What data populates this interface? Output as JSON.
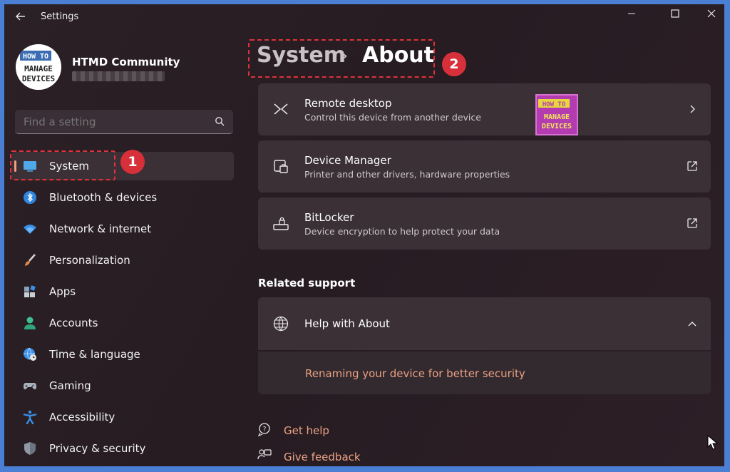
{
  "window": {
    "title": "Settings"
  },
  "profile": {
    "name": "HTMD Community",
    "logo_text_top": "HOW TO",
    "logo_text_mid": "MANAGE",
    "logo_text_bot": "DEVICES"
  },
  "search": {
    "placeholder": "Find a setting"
  },
  "nav": [
    {
      "label": "System",
      "icon": "display-icon"
    },
    {
      "label": "Bluetooth & devices",
      "icon": "bluetooth-icon"
    },
    {
      "label": "Network & internet",
      "icon": "wifi-icon"
    },
    {
      "label": "Personalization",
      "icon": "brush-icon"
    },
    {
      "label": "Apps",
      "icon": "apps-icon"
    },
    {
      "label": "Accounts",
      "icon": "person-icon"
    },
    {
      "label": "Time & language",
      "icon": "globe-clock-icon"
    },
    {
      "label": "Gaming",
      "icon": "controller-icon"
    },
    {
      "label": "Accessibility",
      "icon": "accessibility-icon"
    },
    {
      "label": "Privacy & security",
      "icon": "shield-icon"
    }
  ],
  "annotations": {
    "badge1": "1",
    "badge2": "2"
  },
  "breadcrumb": {
    "parent": "System",
    "separator": "›",
    "current": "About"
  },
  "cards": [
    {
      "title": "Remote desktop",
      "subtitle": "Control this device from another device",
      "icon": "remote-desktop-icon",
      "action": "chevron-right-icon"
    },
    {
      "title": "Device Manager",
      "subtitle": "Printer and other drivers, hardware properties",
      "icon": "device-manager-icon",
      "action": "external-link-icon"
    },
    {
      "title": "BitLocker",
      "subtitle": "Device encryption to help protect your data",
      "icon": "lock-drive-icon",
      "action": "external-link-icon"
    }
  ],
  "related": {
    "title": "Related support",
    "help_title": "Help with About",
    "help_link": "Renaming your device for better security"
  },
  "footer": {
    "get_help": "Get help",
    "give_feedback": "Give feedback"
  },
  "colors": {
    "accent": "#e8a080",
    "highlight": "#e0323a",
    "card": "#3a3036",
    "background": "#261c22"
  }
}
